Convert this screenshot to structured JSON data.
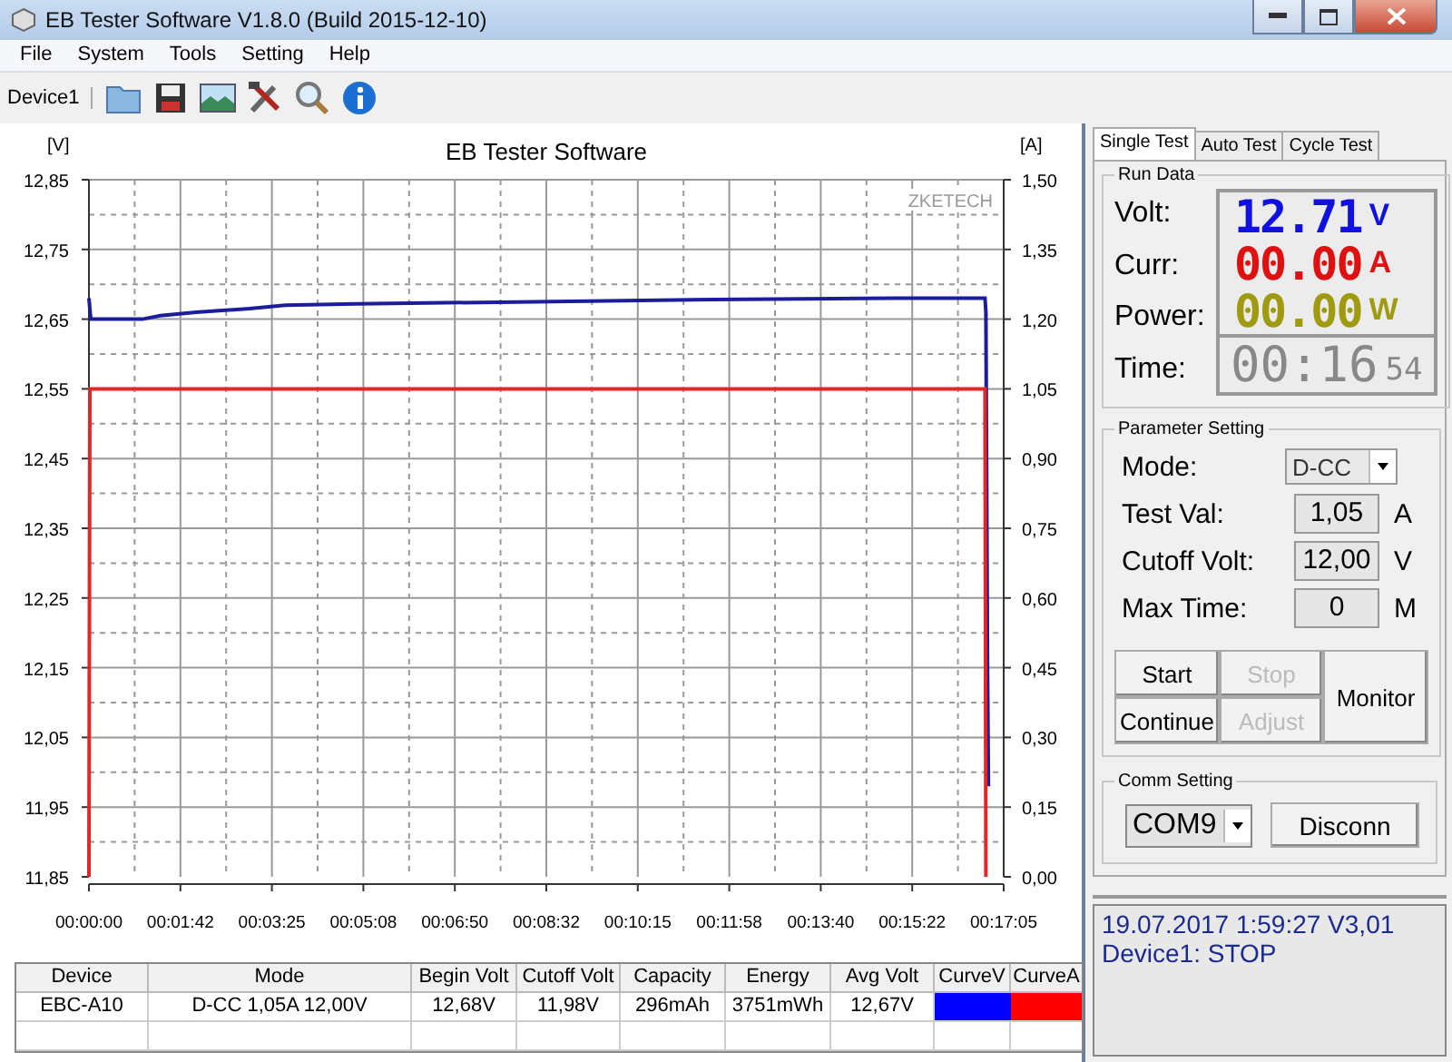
{
  "window": {
    "title": "EB Tester Software V1.8.0 (Build 2015-12-10)"
  },
  "menu": [
    "File",
    "System",
    "Tools",
    "Setting",
    "Help"
  ],
  "toolbar": {
    "device": "Device1"
  },
  "chart": {
    "brand": "ZKETECH",
    "chart_data": {
      "type": "line",
      "grid": true,
      "title": "EB Tester Software",
      "ylabel": "[V]",
      "y2label": "[A]",
      "xlim": [
        0,
        1025
      ],
      "ylim": [
        11.85,
        12.85
      ],
      "y2lim": [
        0,
        1.5
      ],
      "xticks": [
        {
          "value": 0,
          "label": "00:00:00"
        },
        {
          "value": 102.5,
          "label": "00:01:42"
        },
        {
          "value": 205,
          "label": "00:03:25"
        },
        {
          "value": 307.5,
          "label": "00:05:08"
        },
        {
          "value": 410,
          "label": "00:06:50"
        },
        {
          "value": 512.5,
          "label": "00:08:32"
        },
        {
          "value": 615,
          "label": "00:10:15"
        },
        {
          "value": 717.5,
          "label": "00:11:58"
        },
        {
          "value": 820,
          "label": "00:13:40"
        },
        {
          "value": 922.5,
          "label": "00:15:22"
        },
        {
          "value": 1025,
          "label": "00:17:05"
        }
      ],
      "yticks": [
        {
          "value": 11.85,
          "label": "11,85"
        },
        {
          "value": 11.95,
          "label": "11,95"
        },
        {
          "value": 12.05,
          "label": "12,05"
        },
        {
          "value": 12.15,
          "label": "12,15"
        },
        {
          "value": 12.25,
          "label": "12,25"
        },
        {
          "value": 12.35,
          "label": "12,35"
        },
        {
          "value": 12.45,
          "label": "12,45"
        },
        {
          "value": 12.55,
          "label": "12,55"
        },
        {
          "value": 12.65,
          "label": "12,65"
        },
        {
          "value": 12.75,
          "label": "12,75"
        },
        {
          "value": 12.85,
          "label": "12,85"
        }
      ],
      "y2ticks": [
        {
          "value": 0,
          "label": "0,00"
        },
        {
          "value": 0.15,
          "label": "0,15"
        },
        {
          "value": 0.3,
          "label": "0,30"
        },
        {
          "value": 0.45,
          "label": "0,45"
        },
        {
          "value": 0.6,
          "label": "0,60"
        },
        {
          "value": 0.75,
          "label": "0,75"
        },
        {
          "value": 0.9,
          "label": "0,90"
        },
        {
          "value": 1.05,
          "label": "1,05"
        },
        {
          "value": 1.2,
          "label": "1,20"
        },
        {
          "value": 1.35,
          "label": "1,35"
        },
        {
          "value": 1.5,
          "label": "1,50"
        }
      ],
      "series": [
        {
          "color": "#1c1c9c",
          "x": [
            0,
            2,
            60,
            80,
            120,
            180,
            220,
            300,
            500,
            700,
            900,
            1004,
            1005,
            1007,
            1008
          ],
          "values": [
            12.68,
            12.65,
            12.65,
            12.655,
            12.66,
            12.665,
            12.67,
            12.672,
            12.675,
            12.678,
            12.68,
            12.68,
            12.66,
            12.15,
            11.98
          ]
        },
        {
          "axis": "y2",
          "color": "#e02828",
          "x": [
            0,
            1,
            1004,
            1005
          ],
          "values": [
            0,
            1.05,
            1.05,
            0
          ]
        }
      ]
    }
  },
  "table": {
    "columns": [
      "Device",
      "Mode",
      "Begin Volt",
      "Cutoff Volt",
      "Capacity",
      "Energy",
      "Avg Volt",
      "CurveV",
      "CurveA"
    ],
    "rows": [
      {
        "cells": [
          "EBC-A10",
          "D-CC  1,05A  12,00V",
          "12,68V",
          "11,98V",
          "296mAh",
          "3751mWh",
          "12,67V"
        ],
        "curves": [
          {
            "color": "#0000ff"
          },
          {
            "color": "#ff0000"
          }
        ]
      }
    ]
  },
  "tabs": [
    {
      "label": "Single Test",
      "selected": true
    },
    {
      "label": "Auto Test",
      "selected": false
    },
    {
      "label": "Cycle Test",
      "selected": false
    }
  ],
  "run_data": {
    "title": "Run Data",
    "readings": [
      {
        "label": "Volt:",
        "value": "12.71",
        "unit": "V",
        "color": "#1010e0"
      },
      {
        "label": "Curr:",
        "value": "00.00",
        "unit": "A",
        "color": "#e01010"
      },
      {
        "label": "Power:",
        "value": "00.00",
        "unit": "W",
        "color": "#a09a10"
      }
    ],
    "time": {
      "label": "Time:",
      "value": "00:16",
      "seconds": "54"
    }
  },
  "parameter_setting": {
    "title": "Parameter Setting",
    "fields": [
      {
        "kind": "dropdown",
        "label": "Mode:",
        "value": "D-CC"
      },
      {
        "kind": "input",
        "label": "Test Val:",
        "value": "1,05",
        "unit": "A"
      },
      {
        "kind": "input",
        "label": "Cutoff Volt:",
        "value": "12,00",
        "unit": "V"
      },
      {
        "kind": "input",
        "label": "Max Time:",
        "value": "0",
        "unit": "M"
      }
    ],
    "buttons": [
      {
        "label": "Start",
        "disabled": false
      },
      {
        "label": "Stop",
        "disabled": true
      },
      {
        "label": "Continue",
        "disabled": false
      },
      {
        "label": "Adjust",
        "disabled": true
      }
    ],
    "side_button": "Monitor"
  },
  "comm_setting": {
    "title": "Comm Setting",
    "port": "COM9",
    "button": "Disconn"
  },
  "status": {
    "lines": [
      "19.07.2017 1:59:27  V3,01",
      "Device1: STOP"
    ]
  }
}
